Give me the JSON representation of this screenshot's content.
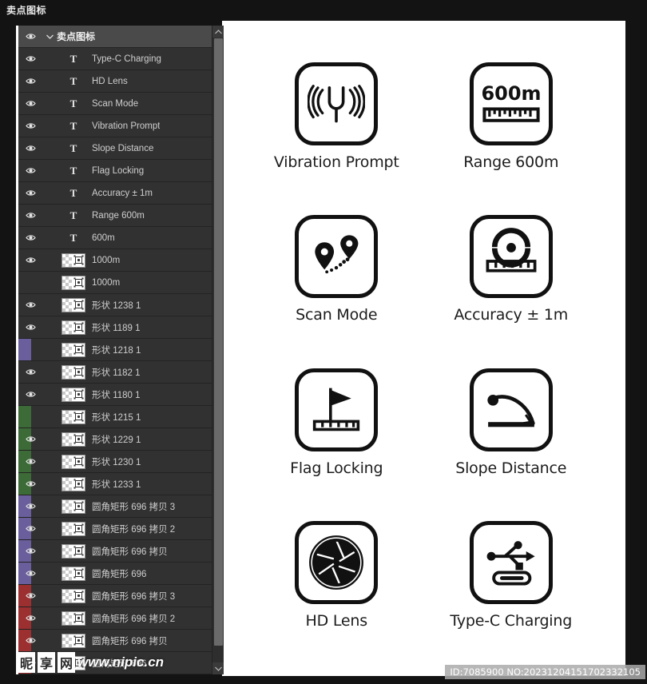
{
  "window": {
    "title": "卖点图标"
  },
  "panel": {
    "scrollbar": {
      "up_arrow": "▲",
      "down_arrow": "▼"
    },
    "group": {
      "label": "卖点图标",
      "twisty": "chevron-down-icon",
      "visible": true
    },
    "rows": [
      {
        "label": "Type-C Charging",
        "kind": "text",
        "visible": true,
        "color": ""
      },
      {
        "label": "HD Lens",
        "kind": "text",
        "visible": true,
        "color": ""
      },
      {
        "label": "Scan Mode",
        "kind": "text",
        "visible": true,
        "color": ""
      },
      {
        "label": "Vibration Prompt",
        "kind": "text",
        "visible": true,
        "color": ""
      },
      {
        "label": "Slope Distance",
        "kind": "text",
        "visible": true,
        "color": ""
      },
      {
        "label": "Flag Locking",
        "kind": "text",
        "visible": true,
        "color": ""
      },
      {
        "label": "Accuracy ± 1m",
        "kind": "text",
        "visible": true,
        "color": ""
      },
      {
        "label": "Range 600m",
        "kind": "text",
        "visible": true,
        "color": ""
      },
      {
        "label": "600m",
        "kind": "text",
        "visible": true,
        "color": ""
      },
      {
        "label": "1000m",
        "kind": "shape",
        "visible": true,
        "color": ""
      },
      {
        "label": "1000m",
        "kind": "shape",
        "visible": false,
        "color": ""
      },
      {
        "label": "形状 1238 1",
        "kind": "shape",
        "visible": true,
        "color": ""
      },
      {
        "label": "形状 1189 1",
        "kind": "shape",
        "visible": true,
        "color": ""
      },
      {
        "label": "形状 1218 1",
        "kind": "shape",
        "visible": false,
        "color": "#6a5f9c"
      },
      {
        "label": "形状 1182 1",
        "kind": "shape",
        "visible": true,
        "color": ""
      },
      {
        "label": "形状 1180 1",
        "kind": "shape",
        "visible": true,
        "color": ""
      },
      {
        "label": "形状 1215 1",
        "kind": "shape",
        "visible": false,
        "color": "#3c6b37"
      },
      {
        "label": "形状 1229 1",
        "kind": "shape",
        "visible": true,
        "color": "#3c6b37"
      },
      {
        "label": "形状 1230 1",
        "kind": "shape",
        "visible": true,
        "color": "#3c6b37"
      },
      {
        "label": "形状 1233 1",
        "kind": "shape",
        "visible": true,
        "color": "#3c6b37"
      },
      {
        "label": "圆角矩形 696 拷贝 3",
        "kind": "shape",
        "visible": true,
        "color": "#6a5f9c"
      },
      {
        "label": "圆角矩形 696 拷贝 2",
        "kind": "shape",
        "visible": true,
        "color": "#6a5f9c"
      },
      {
        "label": "圆角矩形 696 拷贝",
        "kind": "shape",
        "visible": true,
        "color": "#6a5f9c"
      },
      {
        "label": "圆角矩形 696",
        "kind": "shape",
        "visible": true,
        "color": "#6a5f9c"
      },
      {
        "label": "圆角矩形 696 拷贝 3",
        "kind": "shape",
        "visible": true,
        "color": "#9c2f2f"
      },
      {
        "label": "圆角矩形 696 拷贝 2",
        "kind": "shape",
        "visible": true,
        "color": "#9c2f2f"
      },
      {
        "label": "圆角矩形 696 拷贝",
        "kind": "shape",
        "visible": true,
        "color": "#9c2f2f"
      },
      {
        "label": "圆角矩形 696",
        "kind": "shape",
        "visible": true,
        "color": "#9c2f2f"
      }
    ]
  },
  "canvas": {
    "icons": [
      {
        "label": "Vibration Prompt",
        "icon": "tuning-fork-vibration-icon"
      },
      {
        "label": "Range 600m",
        "icon": "ruler-600m-icon"
      },
      {
        "label": "Scan Mode",
        "icon": "map-pins-path-icon"
      },
      {
        "label": "Accuracy ± 1m",
        "icon": "target-ruler-icon"
      },
      {
        "label": "Flag Locking",
        "icon": "flag-ruler-icon"
      },
      {
        "label": "Slope Distance",
        "icon": "slope-arc-icon"
      },
      {
        "label": "HD Lens",
        "icon": "camera-aperture-icon"
      },
      {
        "label": "Type-C Charging",
        "icon": "usb-typec-icon"
      }
    ]
  },
  "watermark": {
    "brand_1": "昵",
    "brand_2": "享",
    "brand_3": "网",
    "url": "www.nipic.cn",
    "id_text": "ID:7085900 NO:20231204151702332105"
  }
}
